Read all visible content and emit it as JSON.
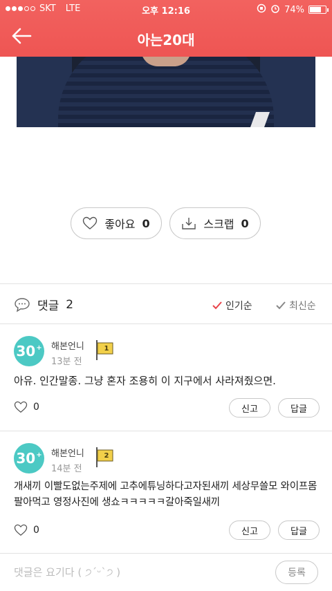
{
  "status_bar": {
    "carrier": "SKT",
    "network": "LTE",
    "time": "오후 12:16",
    "battery": "74%",
    "battery_fraction": 0.74
  },
  "header": {
    "title": "아는20대"
  },
  "actions": {
    "like": {
      "label": "좋아요",
      "count": "0"
    },
    "scrap": {
      "label": "스크랩",
      "count": "0"
    }
  },
  "comments_bar": {
    "label": "댓글",
    "count": "2",
    "sort_popular": "인기순",
    "sort_recent": "최신순"
  },
  "comments": [
    {
      "avatar": "30",
      "author": "해본언니",
      "time": "13분 전",
      "rank": "1",
      "text": "아유. 인간말종. 그냥 혼자 조용히 이 지구에서 사라져줬으면.",
      "likes": "0",
      "report": "신고",
      "reply": "답글"
    },
    {
      "avatar": "30",
      "author": "해본언니",
      "time": "14분 전",
      "rank": "2",
      "text": "개새끼 이빨도없는주제에 고추에튜닝하다고자된새끼 세상무쓸모 와이프몸팔아먹고 영정사진에 생쇼ㅋㅋㅋㅋㅋ갈아죽일새끼",
      "likes": "0",
      "report": "신고",
      "reply": "답글"
    }
  ],
  "input": {
    "placeholder": "댓글은 요기다 ( ੭ˊᵕˋ੭ )",
    "value": "",
    "submit": "등록"
  },
  "colors": {
    "header": "#ee5553",
    "avatar": "#4cc9c4",
    "flag": "#f2d04a",
    "check_active": "#e8444a"
  }
}
